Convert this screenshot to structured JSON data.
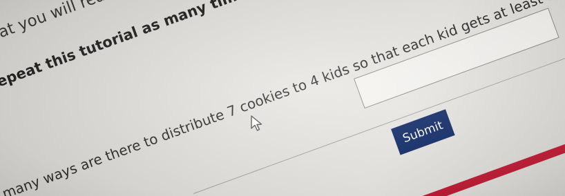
{
  "page": {
    "intro_fragment": "at you will read s",
    "repeat_instruction": "epeat this tutorial as many times",
    "question": "many ways are there to distribute 7 cookies to 4 kids so that each kid gets at least one cooki",
    "answer_value": "",
    "submit_label": "Submit"
  },
  "colors": {
    "submit_background": "#0f2a68",
    "accent_bar": "#c01e37",
    "page_background": "#e6e4e1"
  },
  "icons": {
    "pointer": "mouse-pointer-icon"
  }
}
